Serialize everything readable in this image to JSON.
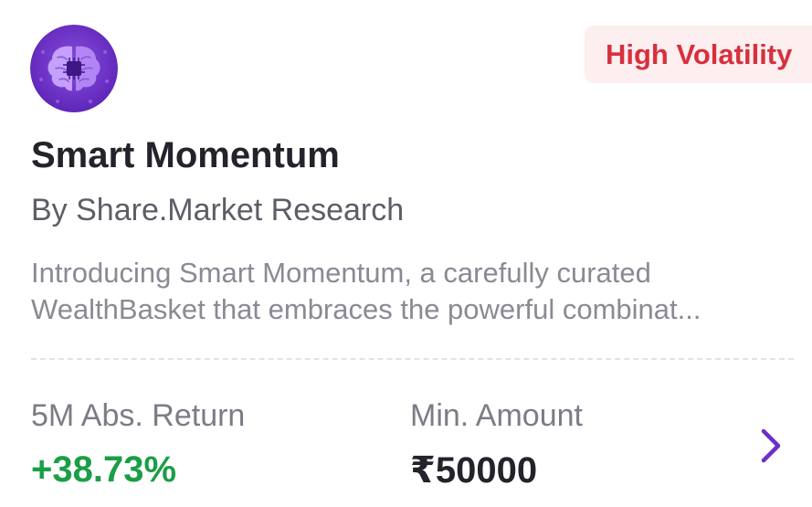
{
  "card": {
    "logo_icon": "brain-chip-icon",
    "badge": "High Volatility",
    "title": "Smart Momentum",
    "byline": "By Share.Market Research",
    "description_lines": [
      "Introducing Smart Momentum, a carefully curated",
      "WealthBasket that embraces the powerful combinat..."
    ],
    "return": {
      "label": "5M Abs. Return",
      "value": "+38.73%"
    },
    "min_amount": {
      "label": "Min. Amount",
      "value": "₹50000"
    },
    "chevron_icon": "chevron-right-icon"
  },
  "colors": {
    "badge_bg": "#fdeef0",
    "badge_text": "#d7303d",
    "positive": "#1a9e47",
    "accent": "#6a2fc9"
  }
}
